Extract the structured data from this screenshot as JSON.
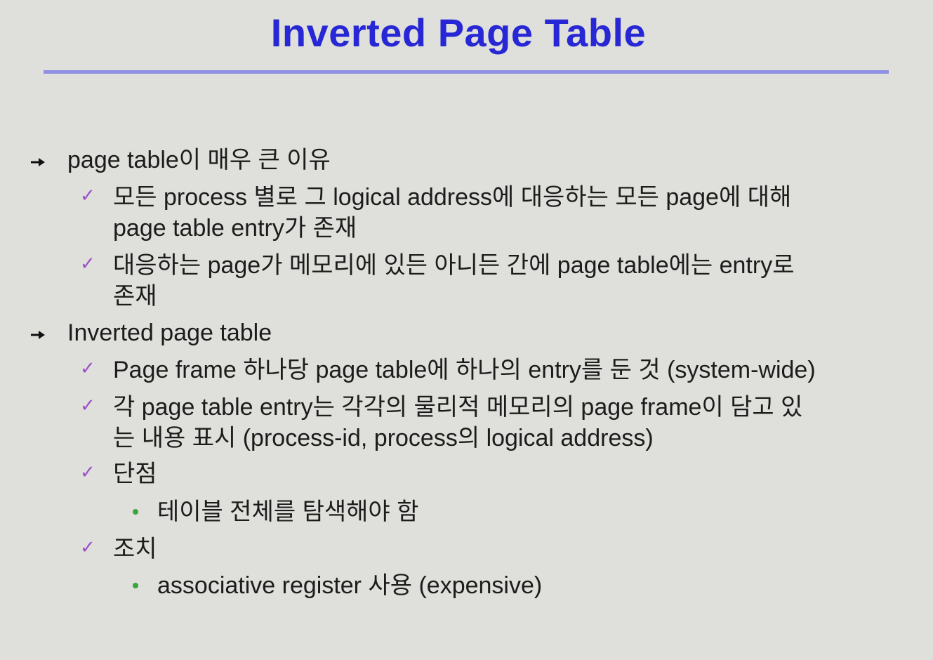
{
  "title": "Inverted Page Table",
  "sections": [
    {
      "heading": "page table이 매우  큰 이유",
      "items": [
        {
          "lines": [
            "모든 process 별로 그 logical address에 대응하는 모든 page에 대해",
            "page table entry가 존재"
          ]
        },
        {
          "lines": [
            "대응하는 page가 메모리에 있든 아니든 간에 page table에는 entry로",
            "존재"
          ]
        }
      ]
    },
    {
      "heading": "Inverted page table",
      "items": [
        {
          "lines": [
            "Page frame 하나당 page table에 하나의 entry를 둔 것 (system-wide)"
          ]
        },
        {
          "lines": [
            "각 page table entry는 각각의 물리적 메모리의 page frame이 담고 있",
            "는 내용 표시 (process-id, process의 logical address)"
          ]
        },
        {
          "lines": [
            "단점"
          ],
          "sub": [
            "테이블 전체를 탐색해야 함"
          ]
        },
        {
          "lines": [
            "조치"
          ],
          "sub": [
            "associative register 사용 (expensive)"
          ]
        }
      ]
    }
  ],
  "markers": {
    "level1": "arrow-icon",
    "level2": "checkmark-icon",
    "level3": "bullet-dot-icon"
  },
  "colors": {
    "title": "#2727d6",
    "rule": "#8f8fe3",
    "checkmark": "#9b4fc7",
    "bullet": "#3aa63a",
    "background": "#dfdfdb"
  }
}
